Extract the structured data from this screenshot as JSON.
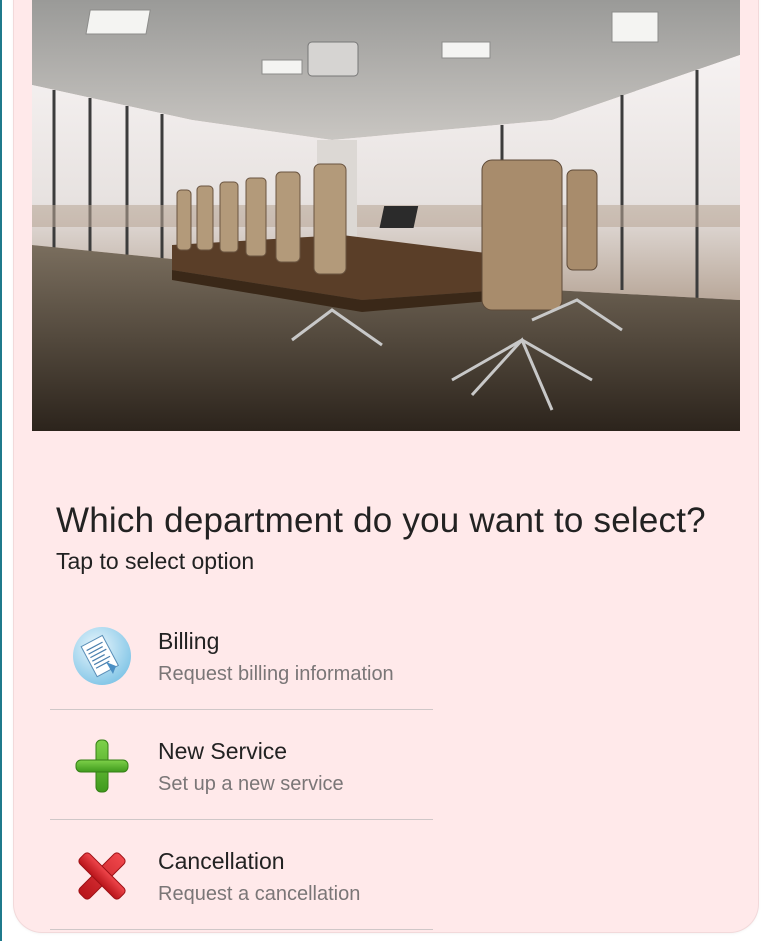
{
  "prompt": {
    "question": "Which department do you want to select?",
    "hint": "Tap to select option"
  },
  "hero_image": {
    "icon": "conference-room-photo"
  },
  "options": [
    {
      "title": "Billing",
      "subtitle": "Request billing information",
      "icon": "billing-receipt-icon",
      "color": "#6fb7e0"
    },
    {
      "title": "New Service",
      "subtitle": "Set up a new service",
      "icon": "plus-icon",
      "color": "#5ab52c"
    },
    {
      "title": "Cancellation",
      "subtitle": "Request a cancellation",
      "icon": "cross-icon",
      "color": "#d81f26"
    }
  ]
}
